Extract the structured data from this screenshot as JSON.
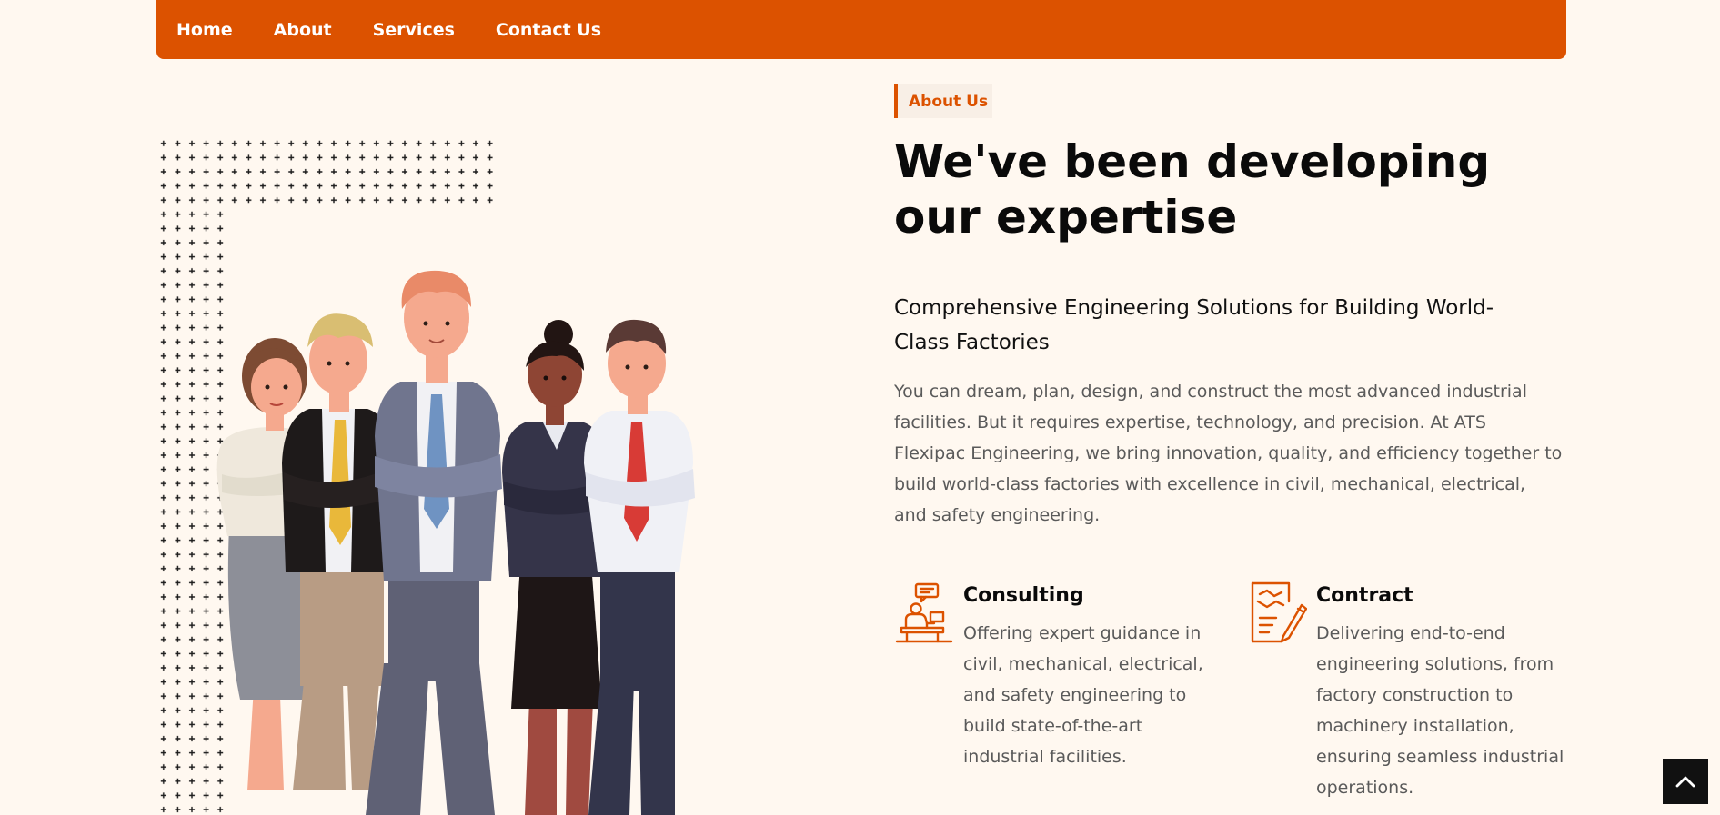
{
  "nav": {
    "items": [
      {
        "label": "Home"
      },
      {
        "label": "About"
      },
      {
        "label": "Services"
      },
      {
        "label": "Contact Us"
      }
    ]
  },
  "about": {
    "tag": "About Us",
    "headline": "We've been developing our expertise",
    "subheadline": "Comprehensive Engineering Solutions for Building World-Class Factories",
    "body": "You can dream, plan, design, and construct the most advanced industrial facilities. But it requires expertise, technology, and precision. At ATS Flexipac Engineering, we bring innovation, quality, and efficiency together to build world-class factories with excellence in civil, mechanical, electrical, and safety engineering."
  },
  "services": [
    {
      "title": "Consulting",
      "description": "Offering expert guidance in civil, mechanical, electrical, and safety engineering to build state-of-the-art industrial facilities.",
      "icon": "consultant-desk-icon"
    },
    {
      "title": "Contract",
      "description": "Delivering end-to-end engineering solutions, from factory construction to machinery installation, ensuring seamless industrial operations.",
      "icon": "handshake-contract-icon"
    }
  ],
  "colors": {
    "accent": "#dc5200",
    "background": "#fff8f0",
    "heading": "#0a0a0a",
    "body_text": "#5a5a5a"
  },
  "back_to_top_icon": "chevron-up-icon"
}
